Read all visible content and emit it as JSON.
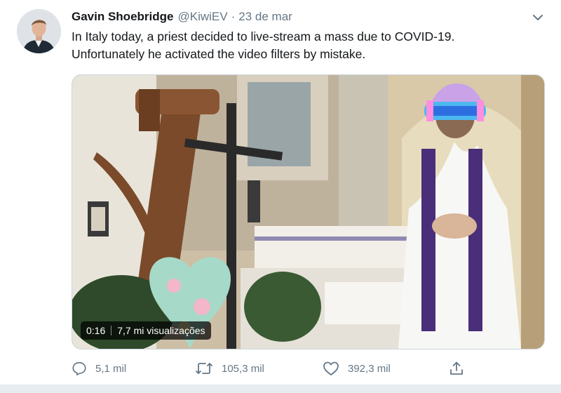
{
  "tweet": {
    "author_name": "Gavin Shoebridge",
    "handle": "@KiwiEV",
    "separator": "·",
    "date": "23 de mar",
    "text_line1": "In Italy today, a priest decided to live-stream a mass due to COVID-19.",
    "text_line2": "Unfortunately he activated the video filters by mistake."
  },
  "video": {
    "duration": "0:16",
    "views": "7,7 mi visualizações"
  },
  "actions": {
    "replies": "5,1 mil",
    "retweets": "105,3 mil",
    "likes": "392,3 mil"
  },
  "icons": {
    "reply": "reply-icon",
    "retweet": "retweet-icon",
    "like": "heart-icon",
    "share": "share-icon",
    "more": "chevron-down-icon"
  },
  "colors": {
    "muted": "#657786",
    "text": "#14171a",
    "band": "#e6ecf0"
  }
}
